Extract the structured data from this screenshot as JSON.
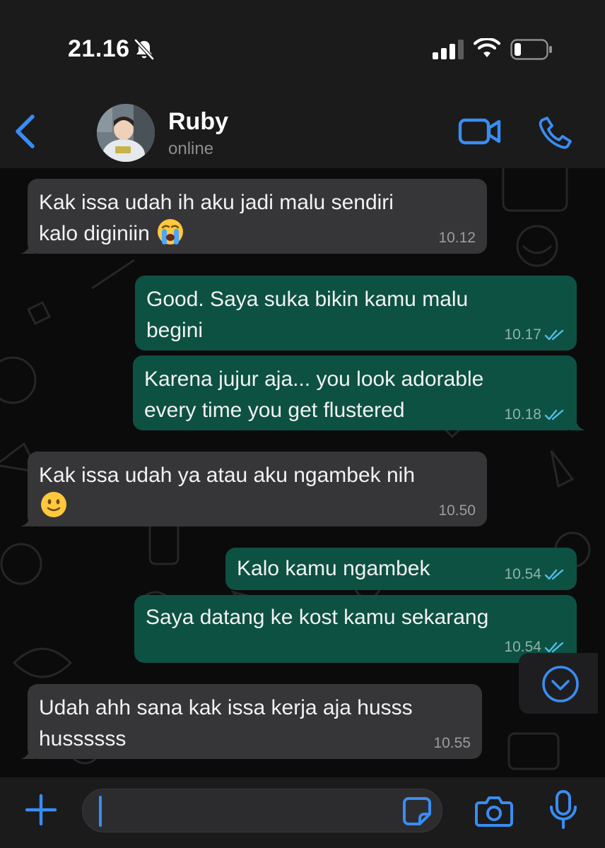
{
  "status_bar": {
    "time": "21.16",
    "icons": [
      "bell-slash-icon",
      "signal-bars-icon",
      "wifi-icon",
      "battery-low-icon"
    ]
  },
  "header": {
    "contact_name": "Ruby",
    "contact_status": "online",
    "icons": [
      "chevron-left-icon",
      "video-camera-icon",
      "phone-icon"
    ]
  },
  "messages": [
    {
      "direction": "incoming",
      "lines": [
        "Kak issa udah ih aku jadi malu sendiri",
        "kalo diginiin"
      ],
      "emoji": "😭",
      "time": "10.12"
    },
    {
      "direction": "outgoing",
      "lines": [
        "Good. Saya suka bikin kamu malu",
        "begini"
      ],
      "time": "10.17",
      "status": "read"
    },
    {
      "direction": "outgoing",
      "lines": [
        "Karena jujur aja... you look adorable",
        "every time you get flustered"
      ],
      "time": "10.18",
      "status": "read"
    },
    {
      "direction": "incoming",
      "lines": [
        "Kak issa udah ya atau aku ngambek nih"
      ],
      "emoji": "🙂",
      "time": "10.50"
    },
    {
      "direction": "outgoing",
      "lines": [
        "Kalo kamu ngambek"
      ],
      "time": "10.54",
      "status": "read"
    },
    {
      "direction": "outgoing",
      "lines": [
        "Saya datang ke kost kamu sekarang"
      ],
      "time": "10.54",
      "status": "read"
    },
    {
      "direction": "incoming",
      "lines": [
        "Udah ahh sana kak issa kerja aja husss",
        "hussssss"
      ],
      "time": "10.55"
    }
  ],
  "input_bar": {
    "message_value": "",
    "icons": [
      "plus-icon",
      "sticker-icon",
      "camera-icon",
      "microphone-icon"
    ]
  },
  "colors": {
    "accent": "#3a8cf2",
    "incoming_bubble": "#363638",
    "outgoing_bubble": "#0d5143",
    "read_ticks": "#53bdeb",
    "background": "#0b0b0b",
    "bar": "#1b1b1b"
  }
}
